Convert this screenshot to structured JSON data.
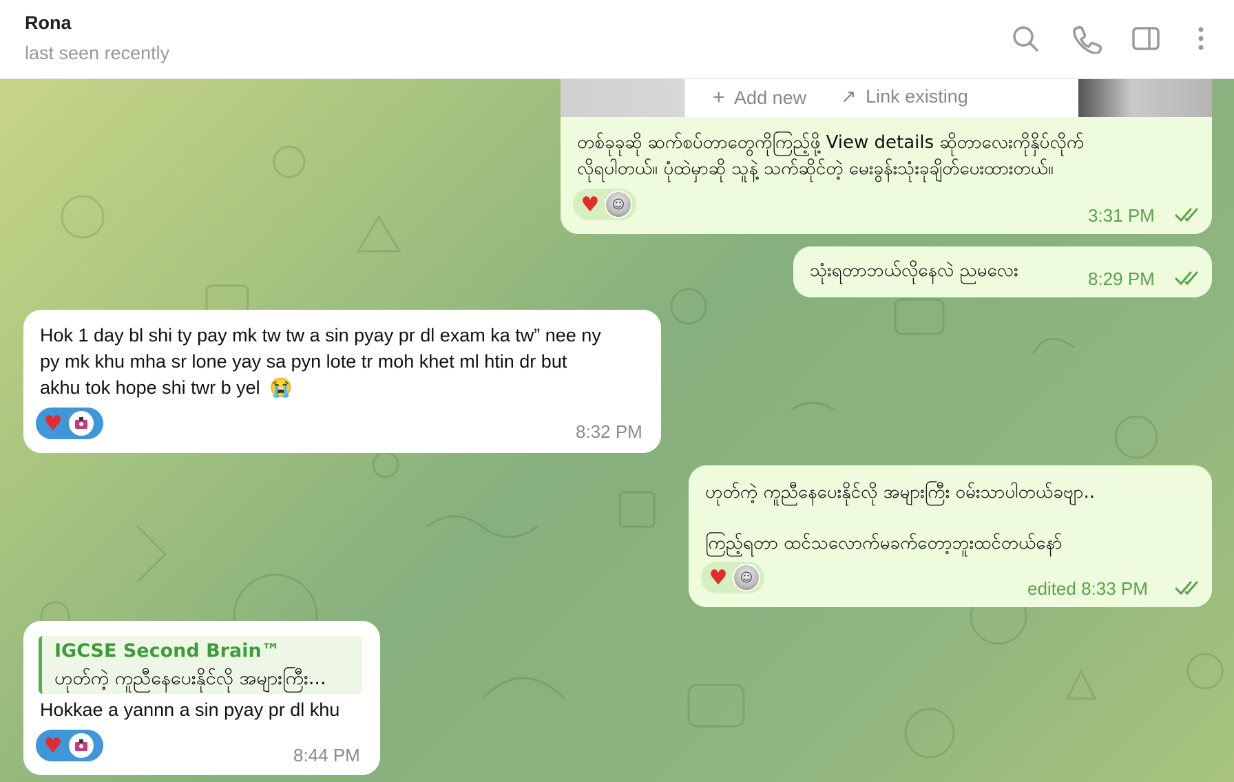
{
  "header": {
    "contact_name": "Rona",
    "status": "last seen recently",
    "icons": [
      "search-icon",
      "phone-icon",
      "sidebar-toggle-icon",
      "more-vertical-icon"
    ]
  },
  "link_widget": {
    "add_new": "Add new",
    "link_existing": "Link existing"
  },
  "messages": [
    {
      "direction": "outgoing",
      "lines": [
        "တစ်ခုခုဆို ဆက်စပ်တာတွေကိုကြည့်ဖို့ View details ဆိုတာလေးကိုနှိပ်လိုက်",
        "လိုရပါတယ်။ ပုံထဲမှာဆို သူနဲ့ သက်ဆိုင်တဲ့ မေးခွန်းသုံးခုချိတ်ပေးထားတယ်။"
      ],
      "reaction": "heart",
      "time": "3:31 PM",
      "read": true
    },
    {
      "direction": "outgoing",
      "lines": [
        "သုံးရတာဘယ်လိုနေလဲ ညမလေး"
      ],
      "time": "8:29 PM",
      "read": true
    },
    {
      "direction": "incoming",
      "lines": [
        "Hok 1 day bl shi ty pay mk tw tw a sin pyay pr dl exam ka tw” nee ny",
        "py mk khu mha sr lone yay sa pyn lote tr moh khet ml htin dr but",
        "akhu tok hope shi twr b yel"
      ],
      "emoji": "😭",
      "reaction": "heart",
      "time": "8:32 PM"
    },
    {
      "direction": "outgoing",
      "lines": [
        "ဟုတ်ကဲ့ ကူညီနေပေးနိုင်လို အများကြီး  ဝမ်းသာပါတယ်ခဗျာ..",
        "",
        "ကြည့်ရတာ ထင်သလောက်မခက်တော့ဘူးထင်တယ်နော်"
      ],
      "reaction": "heart",
      "time": "edited 8:33 PM",
      "read": true
    },
    {
      "direction": "incoming",
      "reply_to": {
        "title": "IGCSE Second Brain™",
        "text": "ဟုတ်ကဲ့ ကူညီနေပေးနိုင်လို အများကြီး..."
      },
      "lines": [
        "Hokkae a yannn a sin pyay pr dl khu"
      ],
      "reaction": "heart",
      "time": "8:44 PM"
    }
  ],
  "colors": {
    "outgoing_bubble": "#eefbdc",
    "incoming_bubble": "#ffffff",
    "outgoing_time": "#5aa24e",
    "reply_accent": "#3d9b3a",
    "reaction_incoming": "#3f96d8"
  }
}
